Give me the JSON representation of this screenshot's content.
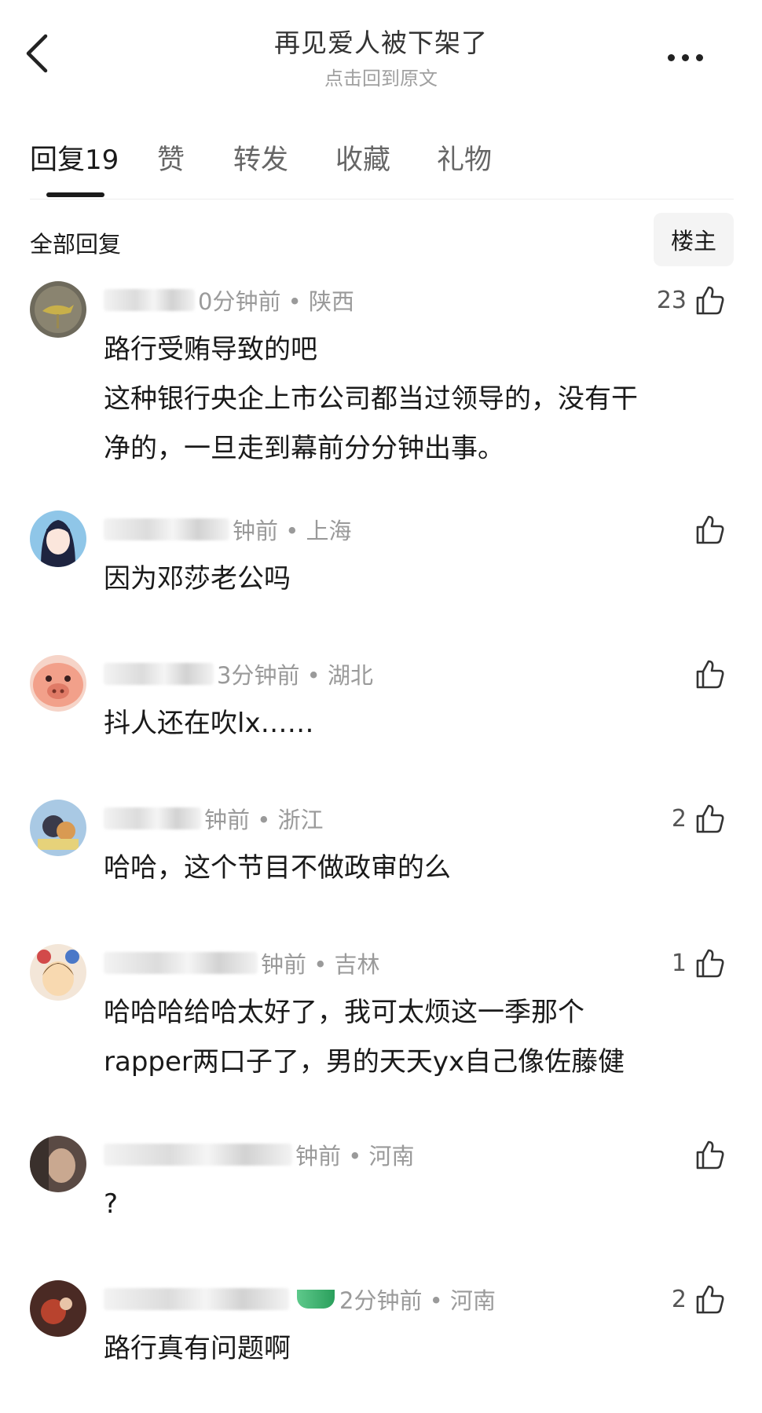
{
  "header": {
    "title": "再见爱人被下架了",
    "subtitle": "点击回到原文"
  },
  "tabs": [
    {
      "label": "回复",
      "count": "19"
    },
    {
      "label": "赞"
    },
    {
      "label": "转发"
    },
    {
      "label": "收藏"
    },
    {
      "label": "礼物"
    }
  ],
  "subheader": {
    "all_replies": "全部回复",
    "op_button": "楼主"
  },
  "comments": [
    {
      "meta": "0分钟前 • 陕西",
      "likes": "23",
      "text": [
        "路行受贿导致的吧",
        "这种银行央企上市公司都当过领导的，没有干",
        "净的，一旦走到幕前分分钟出事。"
      ]
    },
    {
      "meta": "钟前 • 上海",
      "likes": "",
      "text": [
        "因为邓莎老公吗"
      ]
    },
    {
      "meta": "3分钟前 • 湖北",
      "likes": "",
      "text": [
        "抖人还在吹lx……"
      ]
    },
    {
      "meta": "钟前 • 浙江",
      "likes": "2",
      "text": [
        "哈哈，这个节目不做政审的么"
      ]
    },
    {
      "meta": "钟前 • 吉林",
      "likes": "1",
      "text": [
        "哈哈哈给哈太好了，我可太烦这一季那个",
        "rapper两口子了，男的天天yx自己像佐藤健"
      ]
    },
    {
      "meta": "钟前 • 河南",
      "likes": "",
      "text": [
        "?"
      ]
    },
    {
      "meta": "2分钟前 • 河南",
      "likes": "2",
      "text": [
        "路行真有问题啊"
      ]
    }
  ],
  "icons": {
    "back": "chevron-left-icon",
    "more": "more-dots-icon",
    "like": "thumbs-up-icon"
  },
  "colors": {
    "text_primary": "#1a1a1a",
    "text_meta": "#9a9a9a",
    "badge_green": "#2a9f5c"
  }
}
